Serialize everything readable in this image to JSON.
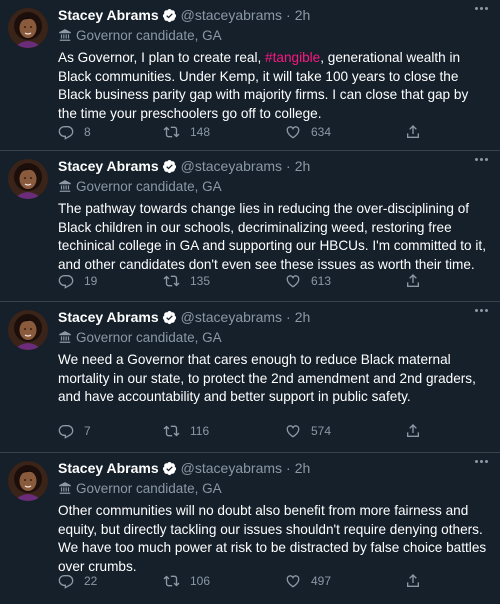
{
  "tweets": [
    {
      "name": "Stacey Abrams",
      "handle": "@staceyabrams",
      "time": "2h",
      "label": "Governor candidate, GA",
      "text_before": "As Governor, I plan to create real, ",
      "hashtag": "#tangible",
      "text_after": ", generational wealth in Black communities. Under Kemp, it will take 100 years to close the Black business parity gap with majority firms. I can close that gap by the time your preschoolers go off to college.",
      "replies": "8",
      "retweets": "148",
      "likes": "634"
    },
    {
      "name": "Stacey Abrams",
      "handle": "@staceyabrams",
      "time": "2h",
      "label": "Governor candidate, GA",
      "text_before": "The pathway towards change lies in  reducing the over-disciplining of Black children in our schools, decriminalizing weed, restoring free techinical college in GA and supporting our HBCUs. I'm committed to it, and other candidates don't even see these issues as worth their time.",
      "hashtag": "",
      "text_after": "",
      "replies": "19",
      "retweets": "135",
      "likes": "613"
    },
    {
      "name": "Stacey Abrams",
      "handle": "@staceyabrams",
      "time": "2h",
      "label": "Governor candidate, GA",
      "text_before": "We need a Governor that cares enough to reduce Black maternal mortality in our state, to protect the 2nd amendment and 2nd graders, and have accountability and better support in public safety.",
      "hashtag": "",
      "text_after": "",
      "replies": "7",
      "retweets": "116",
      "likes": "574"
    },
    {
      "name": "Stacey Abrams",
      "handle": "@staceyabrams",
      "time": "2h",
      "label": "Governor candidate, GA",
      "text_before": "Other communities will no doubt also benefit from more fairness and equity, but directly tackling our issues shouldn't require denying others. We have too much power at risk to be distracted by false choice battles over crumbs.",
      "hashtag": "",
      "text_after": "",
      "replies": "22",
      "retweets": "106",
      "likes": "497"
    }
  ],
  "colors": {
    "background": "#15202b",
    "text": "#ffffff",
    "secondary": "#8b98a5",
    "divider": "#38444d",
    "hashtag": "#f91880",
    "verified": "#1d9bf0"
  },
  "icons": {
    "verified": "verified-badge-icon",
    "label": "government-building-icon",
    "more": "more-dots-icon",
    "reply": "reply-bubble-icon",
    "retweet": "retweet-arrows-icon",
    "like": "heart-icon",
    "share": "share-upload-icon"
  }
}
